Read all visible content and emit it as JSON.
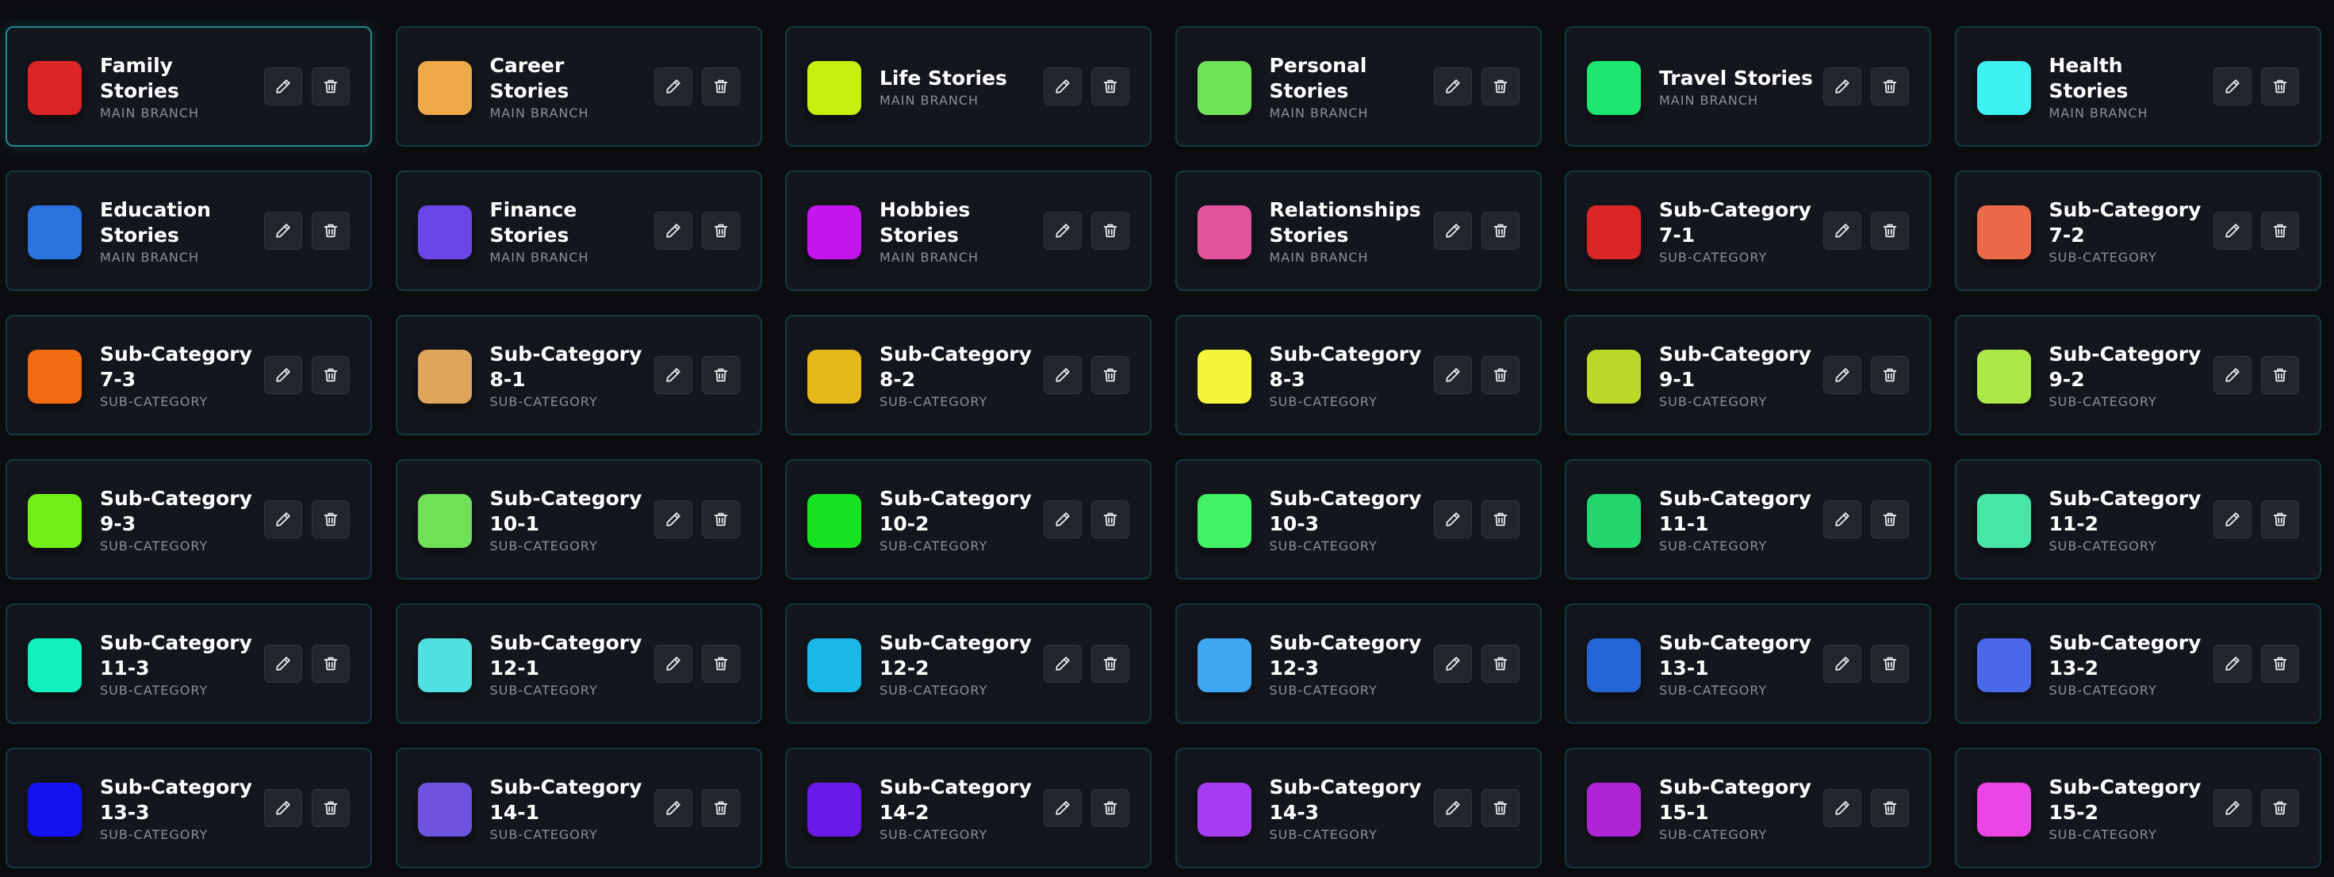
{
  "icons": {
    "edit": "pencil-icon",
    "delete": "trash-icon"
  },
  "selected_index": 0,
  "categories": [
    {
      "title": "Family Stories",
      "subtitle": "MAIN BRANCH",
      "color": "#dc2626"
    },
    {
      "title": "Career Stories",
      "subtitle": "MAIN BRANCH",
      "color": "#eea94a"
    },
    {
      "title": "Life Stories",
      "subtitle": "MAIN BRANCH",
      "color": "#c6ef0e"
    },
    {
      "title": "Personal Stories",
      "subtitle": "MAIN BRANCH",
      "color": "#6ee35a"
    },
    {
      "title": "Travel Stories",
      "subtitle": "MAIN BRANCH",
      "color": "#1ee56e"
    },
    {
      "title": "Health Stories",
      "subtitle": "MAIN BRANCH",
      "color": "#3ef0f0"
    },
    {
      "title": "Education Stories",
      "subtitle": "MAIN BRANCH",
      "color": "#2b73df"
    },
    {
      "title": "Finance Stories",
      "subtitle": "MAIN BRANCH",
      "color": "#6b46e6"
    },
    {
      "title": "Hobbies Stories",
      "subtitle": "MAIN BRANCH",
      "color": "#c416ec"
    },
    {
      "title": "Relationships Stories",
      "subtitle": "MAIN BRANCH",
      "color": "#e2549e"
    },
    {
      "title": "Sub-Category 7-1",
      "subtitle": "SUB-CATEGORY",
      "color": "#dc2626"
    },
    {
      "title": "Sub-Category 7-2",
      "subtitle": "SUB-CATEGORY",
      "color": "#ea6a4a"
    },
    {
      "title": "Sub-Category 7-3",
      "subtitle": "SUB-CATEGORY",
      "color": "#f26b10"
    },
    {
      "title": "Sub-Category 8-1",
      "subtitle": "SUB-CATEGORY",
      "color": "#e0a45a"
    },
    {
      "title": "Sub-Category 8-2",
      "subtitle": "SUB-CATEGORY",
      "color": "#e6b91a"
    },
    {
      "title": "Sub-Category 8-3",
      "subtitle": "SUB-CATEGORY",
      "color": "#f3f53c"
    },
    {
      "title": "Sub-Category 9-1",
      "subtitle": "SUB-CATEGORY",
      "color": "#bcd92a"
    },
    {
      "title": "Sub-Category 9-2",
      "subtitle": "SUB-CATEGORY",
      "color": "#ace848"
    },
    {
      "title": "Sub-Category 9-3",
      "subtitle": "SUB-CATEGORY",
      "color": "#70f016"
    },
    {
      "title": "Sub-Category 10-1",
      "subtitle": "SUB-CATEGORY",
      "color": "#70e058"
    },
    {
      "title": "Sub-Category 10-2",
      "subtitle": "SUB-CATEGORY",
      "color": "#16e220"
    },
    {
      "title": "Sub-Category 10-3",
      "subtitle": "SUB-CATEGORY",
      "color": "#40f264"
    },
    {
      "title": "Sub-Category 11-1",
      "subtitle": "SUB-CATEGORY",
      "color": "#22d56c"
    },
    {
      "title": "Sub-Category 11-2",
      "subtitle": "SUB-CATEGORY",
      "color": "#48e6a6"
    },
    {
      "title": "Sub-Category 11-3",
      "subtitle": "SUB-CATEGORY",
      "color": "#12f0c0"
    },
    {
      "title": "Sub-Category 12-1",
      "subtitle": "SUB-CATEGORY",
      "color": "#50e0e0"
    },
    {
      "title": "Sub-Category 12-2",
      "subtitle": "SUB-CATEGORY",
      "color": "#1ab8e6"
    },
    {
      "title": "Sub-Category 12-3",
      "subtitle": "SUB-CATEGORY",
      "color": "#3ea6f2"
    },
    {
      "title": "Sub-Category 13-1",
      "subtitle": "SUB-CATEGORY",
      "color": "#2466d6"
    },
    {
      "title": "Sub-Category 13-2",
      "subtitle": "SUB-CATEGORY",
      "color": "#4a68ea"
    },
    {
      "title": "Sub-Category 13-3",
      "subtitle": "SUB-CATEGORY",
      "color": "#1212f0"
    },
    {
      "title": "Sub-Category 14-1",
      "subtitle": "SUB-CATEGORY",
      "color": "#6e52e0"
    },
    {
      "title": "Sub-Category 14-2",
      "subtitle": "SUB-CATEGORY",
      "color": "#6a1ae6"
    },
    {
      "title": "Sub-Category 14-3",
      "subtitle": "SUB-CATEGORY",
      "color": "#a63cf0"
    },
    {
      "title": "Sub-Category 15-1",
      "subtitle": "SUB-CATEGORY",
      "color": "#b024d8"
    },
    {
      "title": "Sub-Category 15-2",
      "subtitle": "SUB-CATEGORY",
      "color": "#ea46e6"
    }
  ]
}
